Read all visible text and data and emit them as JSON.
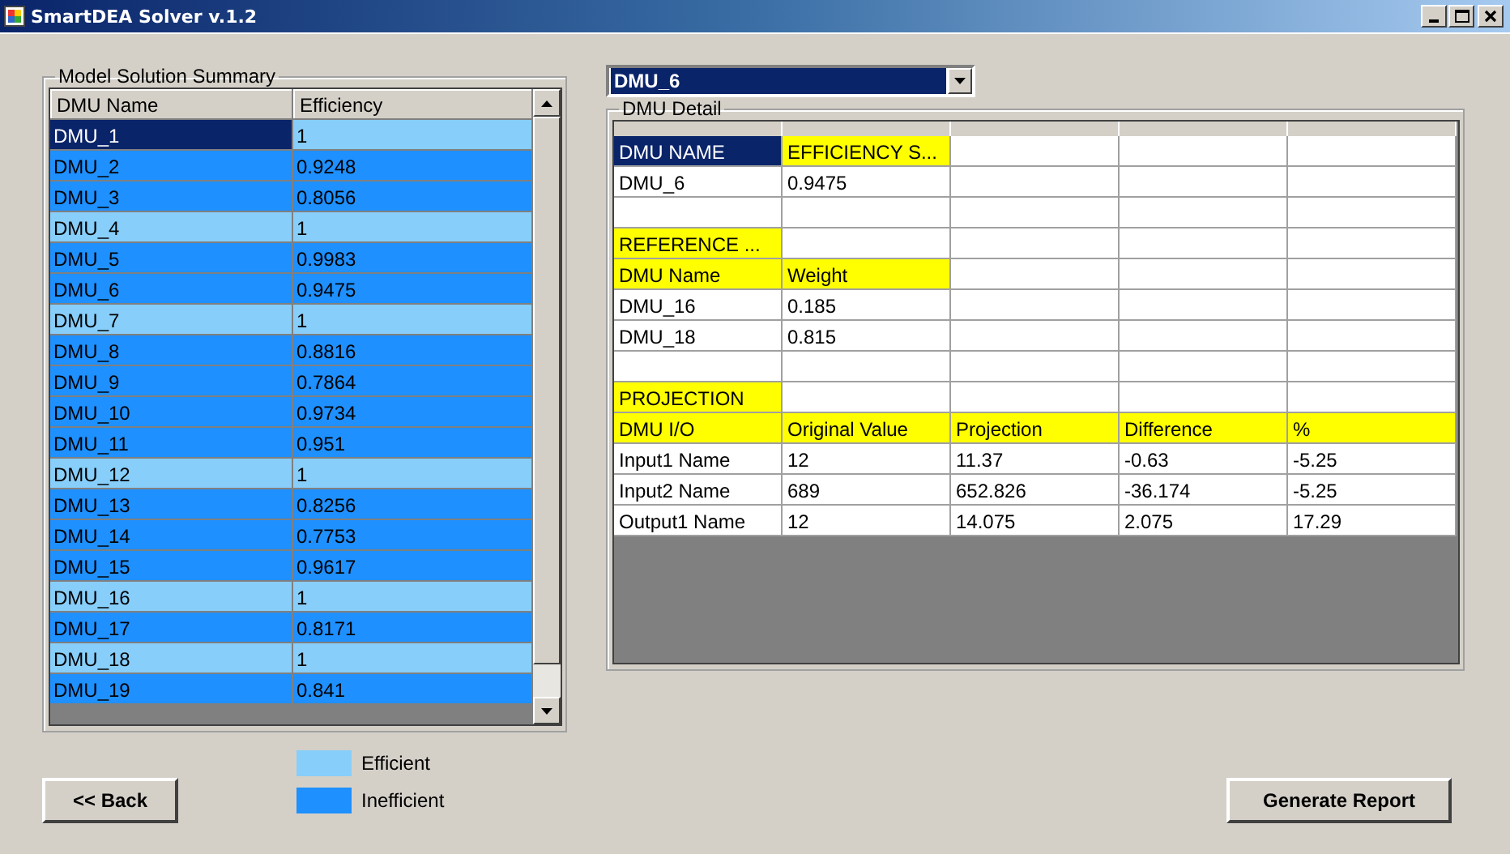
{
  "window": {
    "title": "SmartDEA Solver v.1.2"
  },
  "summary": {
    "title": "Model Solution Summary",
    "columns": [
      "DMU Name",
      "Efficiency"
    ],
    "rows": [
      {
        "name": "DMU_1",
        "efficiency": "1",
        "efficient": true,
        "selected": true
      },
      {
        "name": "DMU_2",
        "efficiency": "0.9248",
        "efficient": false,
        "selected": false
      },
      {
        "name": "DMU_3",
        "efficiency": "0.8056",
        "efficient": false,
        "selected": false
      },
      {
        "name": "DMU_4",
        "efficiency": "1",
        "efficient": true,
        "selected": false
      },
      {
        "name": "DMU_5",
        "efficiency": "0.9983",
        "efficient": false,
        "selected": false
      },
      {
        "name": "DMU_6",
        "efficiency": "0.9475",
        "efficient": false,
        "selected": false
      },
      {
        "name": "DMU_7",
        "efficiency": "1",
        "efficient": true,
        "selected": false
      },
      {
        "name": "DMU_8",
        "efficiency": "0.8816",
        "efficient": false,
        "selected": false
      },
      {
        "name": "DMU_9",
        "efficiency": "0.7864",
        "efficient": false,
        "selected": false
      },
      {
        "name": "DMU_10",
        "efficiency": "0.9734",
        "efficient": false,
        "selected": false
      },
      {
        "name": "DMU_11",
        "efficiency": "0.951",
        "efficient": false,
        "selected": false
      },
      {
        "name": "DMU_12",
        "efficiency": "1",
        "efficient": true,
        "selected": false
      },
      {
        "name": "DMU_13",
        "efficiency": "0.8256",
        "efficient": false,
        "selected": false
      },
      {
        "name": "DMU_14",
        "efficiency": "0.7753",
        "efficient": false,
        "selected": false
      },
      {
        "name": "DMU_15",
        "efficiency": "0.9617",
        "efficient": false,
        "selected": false
      },
      {
        "name": "DMU_16",
        "efficiency": "1",
        "efficient": true,
        "selected": false
      },
      {
        "name": "DMU_17",
        "efficiency": "0.8171",
        "efficient": false,
        "selected": false
      },
      {
        "name": "DMU_18",
        "efficiency": "1",
        "efficient": true,
        "selected": false
      },
      {
        "name": "DMU_19",
        "efficiency": "0.841",
        "efficient": false,
        "selected": false
      }
    ]
  },
  "dmu_select": {
    "value": "DMU_6"
  },
  "detail": {
    "title": "DMU Detail",
    "rows": [
      {
        "kind": "cells",
        "cells": [
          {
            "text": "DMU NAME",
            "kind": "current"
          },
          {
            "text": "EFFICIENCY S...",
            "kind": "header"
          }
        ]
      },
      {
        "kind": "cells",
        "cells": [
          {
            "text": "DMU_6",
            "kind": "plain"
          },
          {
            "text": "0.9475",
            "kind": "plain"
          }
        ]
      },
      {
        "kind": "blank"
      },
      {
        "kind": "cells",
        "cells": [
          {
            "text": "REFERENCE ...",
            "kind": "header"
          }
        ]
      },
      {
        "kind": "cells",
        "cells": [
          {
            "text": "DMU Name",
            "kind": "header"
          },
          {
            "text": "Weight",
            "kind": "header"
          }
        ]
      },
      {
        "kind": "cells",
        "cells": [
          {
            "text": "DMU_16",
            "kind": "plain"
          },
          {
            "text": "0.185",
            "kind": "plain"
          }
        ]
      },
      {
        "kind": "cells",
        "cells": [
          {
            "text": "DMU_18",
            "kind": "plain"
          },
          {
            "text": "0.815",
            "kind": "plain"
          }
        ]
      },
      {
        "kind": "blank"
      },
      {
        "kind": "cells",
        "cells": [
          {
            "text": "PROJECTION",
            "kind": "header"
          }
        ]
      },
      {
        "kind": "cells",
        "cells": [
          {
            "text": "DMU I/O",
            "kind": "header"
          },
          {
            "text": "Original Value",
            "kind": "header"
          },
          {
            "text": "Projection",
            "kind": "header"
          },
          {
            "text": "Difference",
            "kind": "header"
          },
          {
            "text": "%",
            "kind": "header"
          }
        ]
      },
      {
        "kind": "cells",
        "cells": [
          {
            "text": "Input1 Name",
            "kind": "plain"
          },
          {
            "text": "12",
            "kind": "plain"
          },
          {
            "text": "11.37",
            "kind": "plain"
          },
          {
            "text": "-0.63",
            "kind": "plain"
          },
          {
            "text": "-5.25",
            "kind": "plain"
          }
        ]
      },
      {
        "kind": "cells",
        "cells": [
          {
            "text": "Input2 Name",
            "kind": "plain"
          },
          {
            "text": "689",
            "kind": "plain"
          },
          {
            "text": "652.826",
            "kind": "plain"
          },
          {
            "text": "-36.174",
            "kind": "plain"
          },
          {
            "text": "-5.25",
            "kind": "plain"
          }
        ]
      },
      {
        "kind": "cells",
        "cells": [
          {
            "text": "Output1 Name",
            "kind": "plain"
          },
          {
            "text": "12",
            "kind": "plain"
          },
          {
            "text": "14.075",
            "kind": "plain"
          },
          {
            "text": "2.075",
            "kind": "plain"
          },
          {
            "text": "17.29",
            "kind": "plain"
          }
        ]
      }
    ]
  },
  "legend": [
    {
      "label": "Efficient",
      "color": "#87cefa"
    },
    {
      "label": "Inefficient",
      "color": "#1e90ff"
    }
  ],
  "buttons": {
    "back": "<< Back",
    "report": "Generate Report"
  }
}
